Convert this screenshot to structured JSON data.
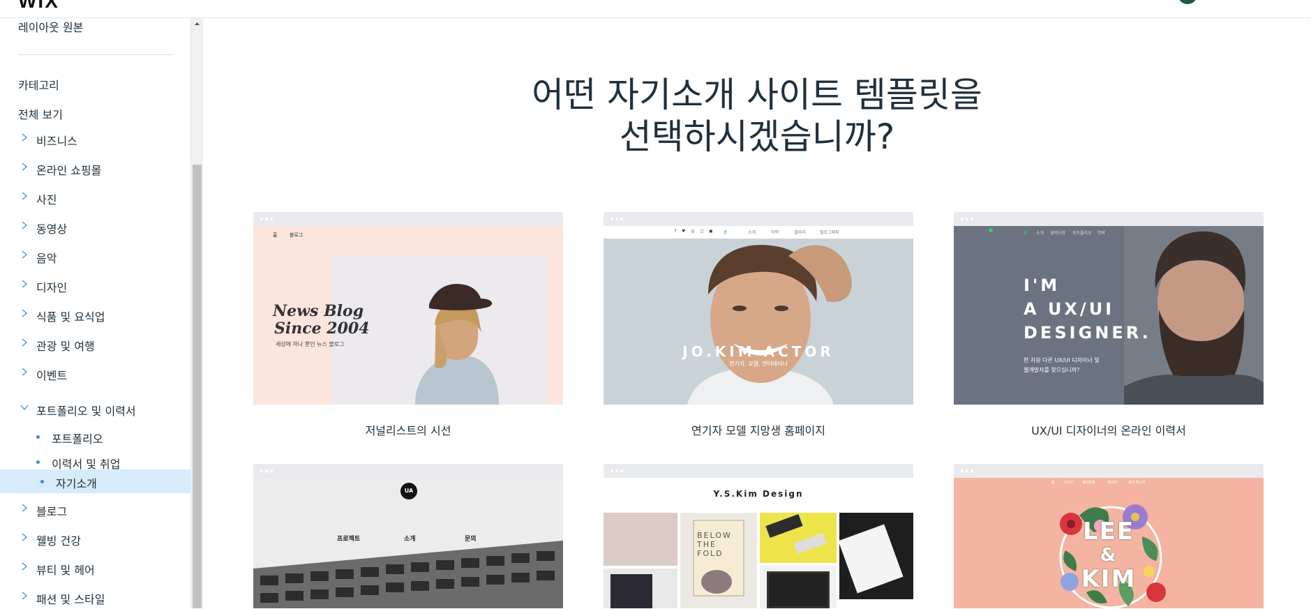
{
  "sidebar": {
    "layout_original": "레이아웃 원본",
    "categories_heading": "카테고리",
    "view_all": "전체 보기",
    "categories": [
      "비즈니스",
      "온라인 쇼핑몰",
      "사진",
      "동영상",
      "음악",
      "디자인",
      "식품 및 요식업",
      "관광 및 여행",
      "이벤트"
    ],
    "expanded_category": "포트폴리오 및 이력서",
    "subcategories": [
      "포트폴리오",
      "이력서 및 취업",
      "자기소개"
    ],
    "more_categories": [
      "블로그",
      "웰빙 건강",
      "뷰티 및 헤어",
      "패션 및 스타일"
    ]
  },
  "main": {
    "heading_line1": "어떤 자기소개 사이트 템플릿을",
    "heading_line2": "선택하시겠습니까?"
  },
  "templates": [
    {
      "caption": "저널리스트의 시선",
      "nav": [
        "홈",
        "블로그"
      ],
      "title_line1": "News Blog",
      "title_line2": "Since 2004",
      "subtitle": "세상에 하나 뿐인 뉴스 블로그"
    },
    {
      "caption": "연기자 모델 지망생 홈페이지",
      "nav": [
        "홈",
        "소개",
        "이력",
        "갤러리",
        "필모그래피"
      ],
      "title": "JO.KIM ACTOR",
      "subtitle": "연기자, 모델, 엔터테이너"
    },
    {
      "caption": "UX/UI 디자이너의 온라인 이력서",
      "nav": [
        "홈",
        "소개",
        "경력사항",
        "포트폴리오",
        "연락"
      ],
      "title_line1": "I'M",
      "title_line2": "A UX/UI",
      "title_line3": "DESIGNER.",
      "subtitle_line1": "한 차원 다른 UX/UI 디자이너 및",
      "subtitle_line2": "웹개발자를 찾으십니까?"
    },
    {
      "logo": "UA",
      "nav": [
        "프로젝트",
        "소개",
        "문의"
      ]
    },
    {
      "title": "Y.S.Kim Design",
      "poster_text": "BELOW THE FOLD"
    },
    {
      "nav": [
        "홈",
        "이야기",
        "웨딩일정",
        "갤러리",
        "축하 메시지"
      ],
      "title_line1": "LEE",
      "title_line2": "&",
      "title_line3": "KIM"
    }
  ],
  "colors": {
    "accent_blue": "#3a8de0",
    "active_bg": "#d6ecfb",
    "text": "#20303c",
    "designer_green": "#2fd16c"
  }
}
